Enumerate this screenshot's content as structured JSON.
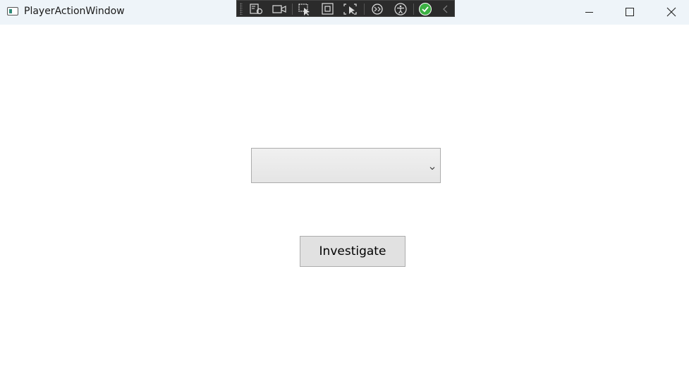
{
  "window": {
    "title": "PlayerActionWindow"
  },
  "debug_toolbar": {
    "icons": [
      "live-visual-tree-icon",
      "record-icon",
      "select-element-icon",
      "display-layout-adorners-icon",
      "track-focus-icon",
      "hot-reload-icon",
      "accessibility-icon",
      "binding-check-icon",
      "collapse-icon"
    ],
    "accent_color": "#3cb043"
  },
  "main": {
    "combo_value": "",
    "action_button_label": "Investigate"
  },
  "colors": {
    "titlebar_bg": "#eef4f9",
    "button_bg": "#e1e1e1",
    "toolbar_bg": "#2b2b2b"
  }
}
